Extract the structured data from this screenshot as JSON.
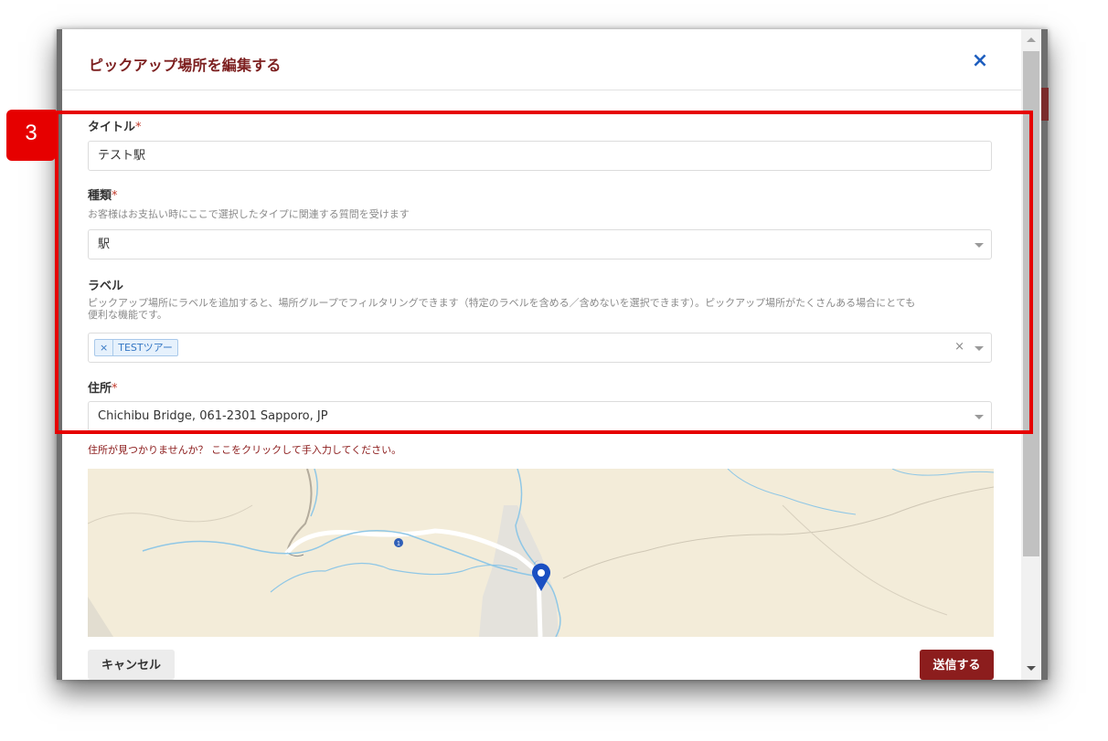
{
  "modal": {
    "title": "ピックアップ場所を編集する",
    "close_icon": "×"
  },
  "form": {
    "title_field": {
      "label": "タイトル",
      "required_mark": "*",
      "value": "テスト駅"
    },
    "type_field": {
      "label": "種類",
      "required_mark": "*",
      "help": "お客様はお支払い時にここで選択したタイプに関連する質問を受けます",
      "selected": "駅"
    },
    "label_field": {
      "label": "ラベル",
      "help_line1": "ピックアップ場所にラベルを追加すると、場所グループでフィルタリングできます（特定のラベルを含める／含めないを選択できます）。ピックアップ場所がたくさんある場合にとても",
      "help_line2": "便利な機能です。",
      "tags": [
        {
          "remove": "×",
          "label": "TESTツアー"
        }
      ],
      "clear": "×"
    },
    "address_field": {
      "label": "住所",
      "required_mark": "*",
      "selected": "Chichibu Bridge, 061-2301 Sapporo, JP"
    },
    "address_hint": "住所が見つかりませんか？ ここをクリックして手入力してください。",
    "map": {
      "road_marker": "1"
    }
  },
  "actions": {
    "cancel": "キャンセル",
    "submit": "送信する"
  },
  "annotation": {
    "step_number": "3"
  },
  "colors": {
    "brand": "#8c1d1d",
    "title": "#7c1f1f",
    "close": "#1f5fbf",
    "highlight": "#e60000",
    "tag_bg": "#e6f1fc",
    "map_bg": "#f3ecd9",
    "pin": "#1a4fc2"
  },
  "icons": {
    "close": "close-icon",
    "dropdown": "chevron-down-icon",
    "tag_remove": "close-icon",
    "map_pin": "map-pin-icon"
  }
}
